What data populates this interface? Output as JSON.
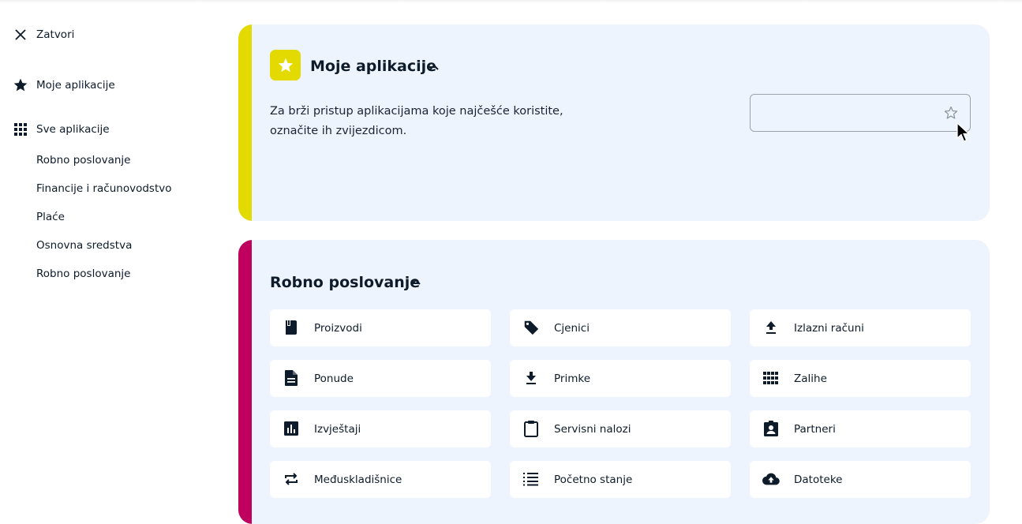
{
  "sidebar": {
    "close_label": "Zatvori",
    "my_apps_label": "Moje aplikacije",
    "all_apps_label": "Sve aplikacije",
    "categories": [
      "Robno poslovanje",
      "Financije i računovodstvo",
      "Plaće",
      "Osnovna sredstva",
      "Robno poslovanje"
    ]
  },
  "my_apps": {
    "title": "Moje aplikacije",
    "description_line1": "Za brži pristup aplikacijama koje najčešće koristite,",
    "description_line2": "označite ih zvijezdicom.",
    "accent_color": "#e2da00"
  },
  "robno": {
    "title": "Robno poslovanje",
    "accent_color": "#c0005f",
    "apps": [
      {
        "label": "Proizvodi",
        "icon": "book-icon"
      },
      {
        "label": "Cjenici",
        "icon": "tag-icon"
      },
      {
        "label": "Izlazni računi",
        "icon": "upload-icon"
      },
      {
        "label": "Ponude",
        "icon": "document-icon"
      },
      {
        "label": "Primke",
        "icon": "download-icon"
      },
      {
        "label": "Zalihe",
        "icon": "grid-icon"
      },
      {
        "label": "Izvještaji",
        "icon": "bar-chart-icon"
      },
      {
        "label": "Servisni nalozi",
        "icon": "clipboard-icon"
      },
      {
        "label": "Partneri",
        "icon": "contact-badge-icon"
      },
      {
        "label": "Međuskladišnice",
        "icon": "swap-icon"
      },
      {
        "label": "Početno stanje",
        "icon": "list-icon"
      },
      {
        "label": "Datoteke",
        "icon": "cloud-upload-icon"
      }
    ]
  },
  "colors": {
    "card_bg": "#eef4fd",
    "text": "#0d1b2a"
  }
}
